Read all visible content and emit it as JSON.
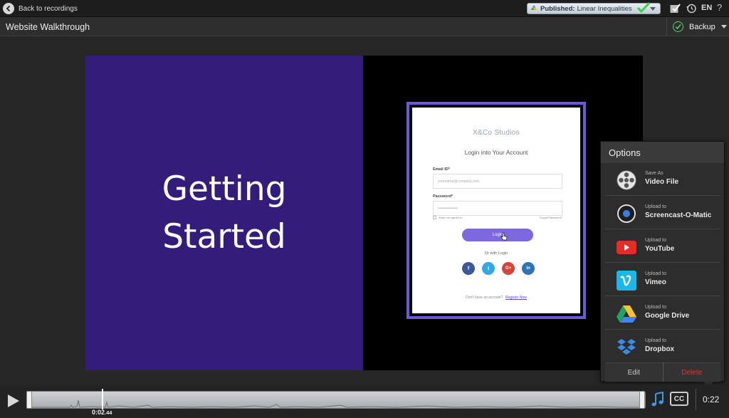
{
  "topbar": {
    "back_label": "Back to recordings",
    "publish_key": "Published:",
    "publish_value": "Linear Inequalities",
    "language": "EN",
    "help": "?"
  },
  "titlebar": {
    "title": "Website Walkthrough",
    "backup_label": "Backup"
  },
  "video": {
    "slide_title": "Getting Started",
    "login": {
      "brand": "X&Co Studios",
      "heading": "Login into Your Account",
      "email_label": "Email ID*",
      "email_placeholder": "yourname@company.com",
      "password_label": "Password*",
      "password_value": "••••••••••••••••",
      "remember": "Keep me signed in",
      "forgot": "Forgot Password?",
      "login_button": "Login",
      "or_login": "Or with Login",
      "social": [
        "f",
        "t",
        "G+",
        "in"
      ],
      "register_prefix": "Don't have an account?",
      "register_link": "Register Now"
    }
  },
  "options": {
    "title": "Options",
    "items": [
      {
        "small": "Save As",
        "big": "Video File",
        "icon": "film-reel-icon"
      },
      {
        "small": "Upload to",
        "big": "Screencast-O-Matic",
        "icon": "screencast-o-matic-icon"
      },
      {
        "small": "Upload to",
        "big": "YouTube",
        "icon": "youtube-icon"
      },
      {
        "small": "Upload to",
        "big": "Vimeo",
        "icon": "vimeo-icon"
      },
      {
        "small": "Upload to",
        "big": "Google Drive",
        "icon": "google-drive-icon"
      },
      {
        "small": "Upload to",
        "big": "Dropbox",
        "icon": "dropbox-icon"
      }
    ],
    "edit_label": "Edit",
    "delete_label": "Delete"
  },
  "controls": {
    "time_main": "0:02",
    "time_ms": ".44",
    "cc_label": "CC",
    "duration": "0:22"
  },
  "colors": {
    "slide_purple": "#341c7a",
    "login_accent": "#7d68e0",
    "delete_red": "#e03030",
    "backup_green": "#5bd06a"
  }
}
